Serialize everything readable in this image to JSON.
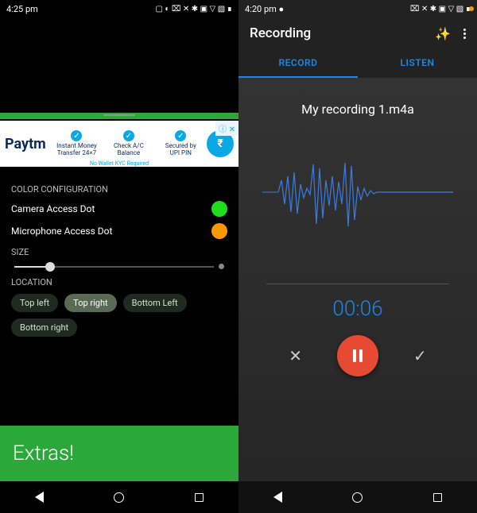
{
  "left": {
    "status": {
      "time": "4:25 pm",
      "icons": "▢ ◐   ⌧ ✕ ✱ ▣ ▽ ▧ ∎"
    },
    "ad": {
      "brand": "Paytm",
      "cols": [
        {
          "title": "Instant Money",
          "sub": "Transfer 24×7"
        },
        {
          "title": "Check A/C",
          "sub": "Balance"
        },
        {
          "title": "Secured by",
          "sub": "UPI PIN"
        }
      ],
      "badge": "₹",
      "footer": "No Wallet KYC Required",
      "close": "ⓘ ✕"
    },
    "sections": {
      "color_title": "COLOR CONFIGURATION",
      "camera_label": "Camera Access Dot",
      "mic_label": "Microphone Access Dot",
      "camera_color": "#1ede1e",
      "mic_color": "#ff9800",
      "size_title": "SIZE",
      "location_title": "LOCATION",
      "chips": {
        "tl": "Top left",
        "tr": "Top right",
        "bl": "Bottom Left",
        "br": "Bottom right"
      },
      "selected": "tr"
    },
    "extras": "Extras!"
  },
  "right": {
    "status": {
      "time": "4:20 pm",
      "icons": "⌧ ✕ ✱ ▣ ▽ ▧ ∎"
    },
    "appbar": {
      "title": "Recording"
    },
    "tabs": {
      "record": "RECORD",
      "listen": "LISTEN"
    },
    "filename": "My recording 1.m4a",
    "timer": "00:06"
  }
}
